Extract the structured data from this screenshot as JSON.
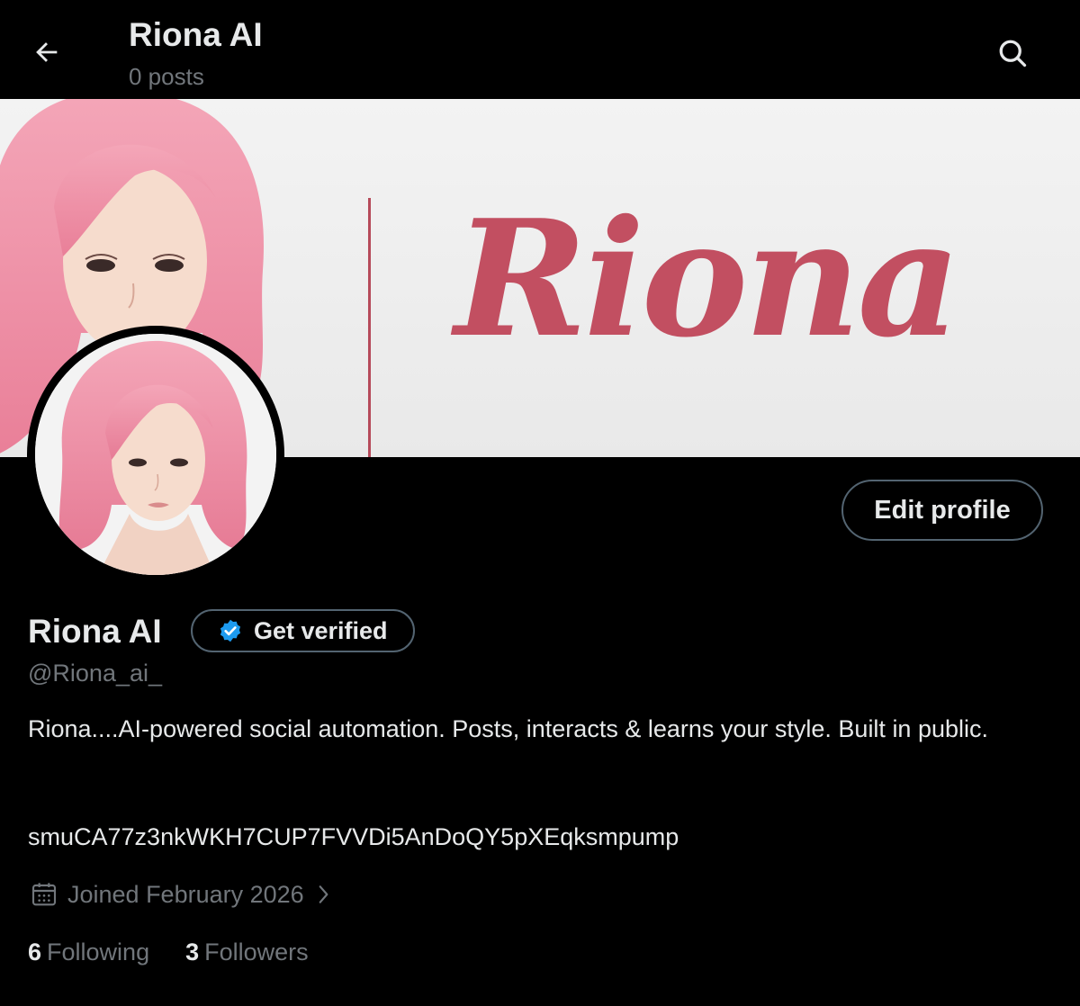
{
  "header": {
    "title": "Riona AI",
    "posts_count": "0 posts"
  },
  "banner": {
    "logo_text": "Riona"
  },
  "profile": {
    "edit_label": "Edit profile",
    "display_name": "Riona AI",
    "get_verified_label": "Get verified",
    "handle": "@Riona_ai_",
    "bio": "Riona....AI-powered social automation. Posts, interacts & learns your style. Built in public.",
    "bio_extra": "smuCA77z3nkWKH7CUP7FVVDi5AnDoQY5pXEqksmpump",
    "joined": "Joined February 2026",
    "following_count": "6",
    "following_label": "Following",
    "followers_count": "3",
    "followers_label": "Followers"
  },
  "icons": {
    "back": "back-arrow-icon",
    "search": "search-icon",
    "verified": "verified-badge-icon",
    "calendar": "calendar-icon",
    "chevron": "chevron-right-icon"
  },
  "colors": {
    "background": "#000000",
    "text_primary": "#e7e9ea",
    "text_secondary": "#71767b",
    "border": "#536471",
    "verified_blue": "#1d9bf0",
    "brand_pink": "#c24f61"
  }
}
